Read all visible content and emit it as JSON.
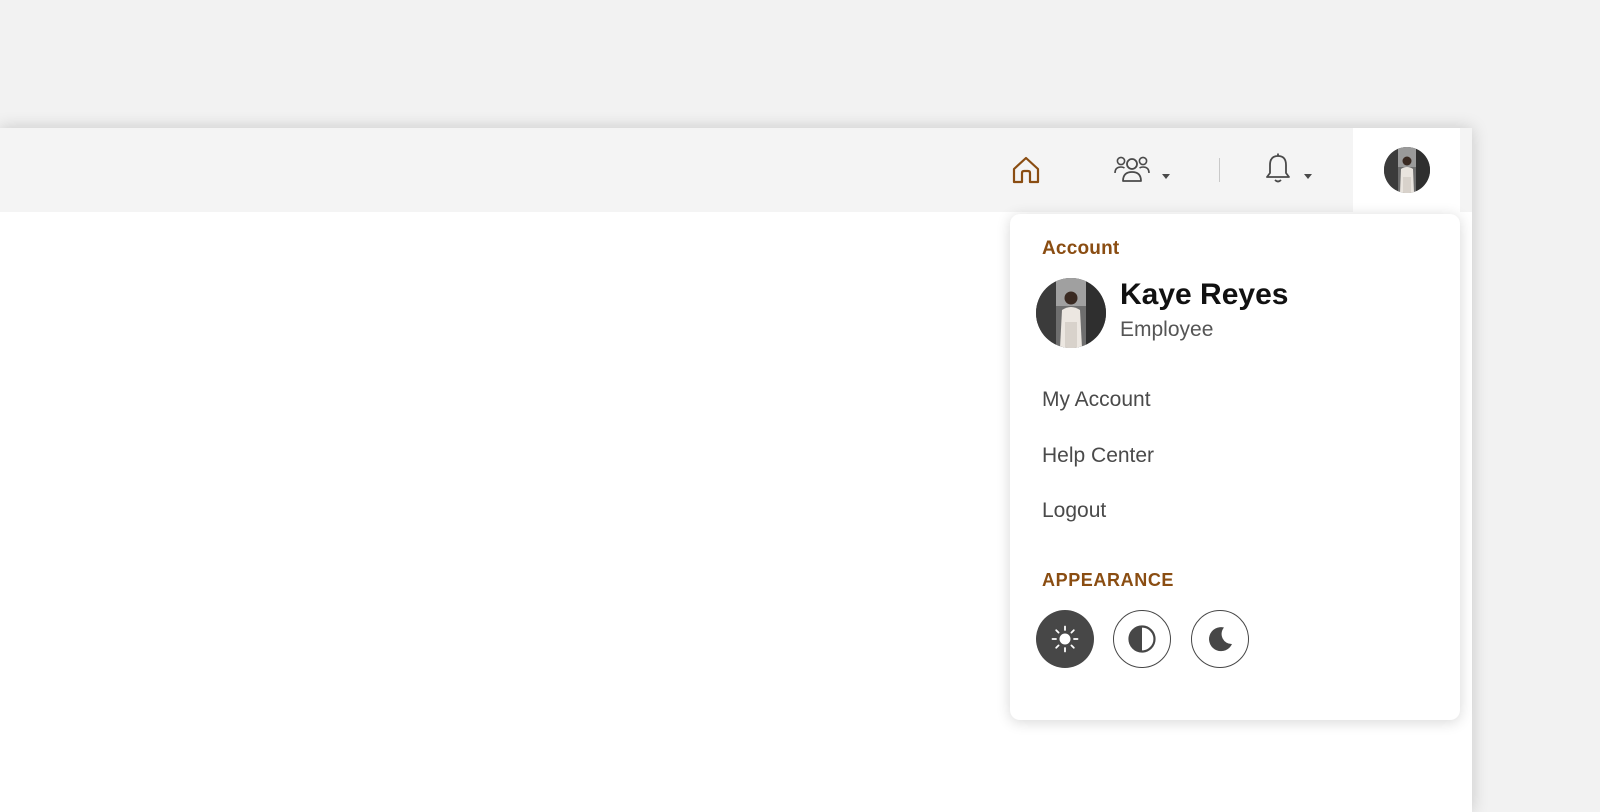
{
  "topbar": {
    "icons": {
      "home": "home-icon",
      "team": "team-icon",
      "notifications": "bell-icon",
      "caret": "chevron-down-icon"
    },
    "accent_color": "#8a4d12"
  },
  "account_menu": {
    "section_label": "Account",
    "user": {
      "name": "Kaye Reyes",
      "role": "Employee"
    },
    "items": [
      {
        "label": "My Account"
      },
      {
        "label": "Help Center"
      },
      {
        "label": "Logout"
      }
    ],
    "appearance": {
      "label": "APPEARANCE",
      "options": [
        {
          "name": "light",
          "icon": "sun-icon",
          "selected": true
        },
        {
          "name": "contrast",
          "icon": "contrast-icon",
          "selected": false
        },
        {
          "name": "dark",
          "icon": "moon-icon",
          "selected": false
        }
      ]
    }
  },
  "colors": {
    "label_accent": "#8a4d12",
    "selected_theme_bg": "#474747",
    "topbar_bg": "#f4f4f4",
    "page_bg": "#f2f2f2"
  }
}
